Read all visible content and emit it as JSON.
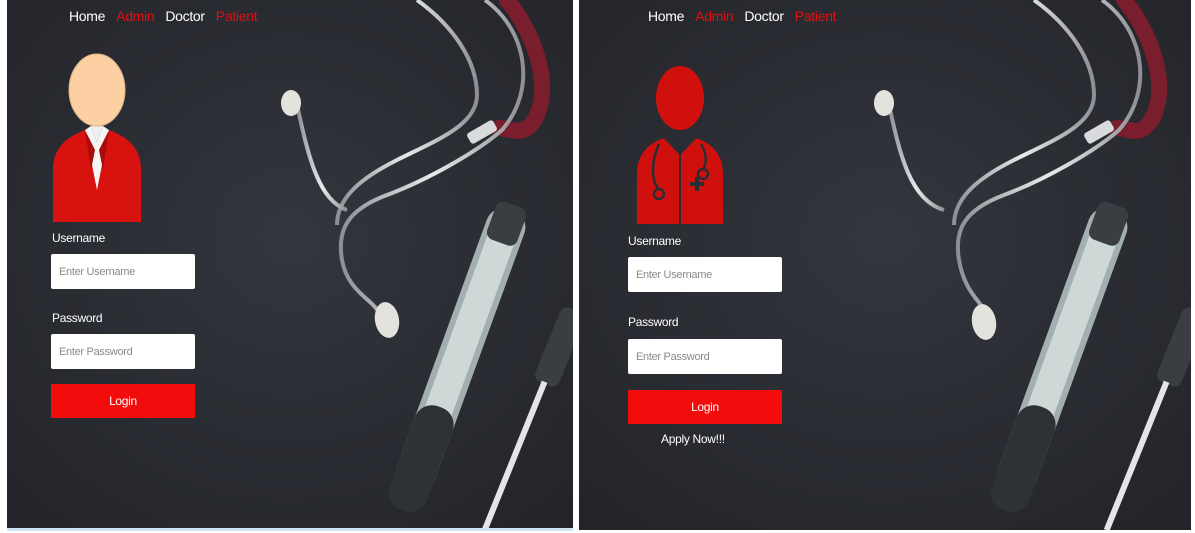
{
  "admin_panel": {
    "nav": {
      "home": "Home",
      "admin": "Admin",
      "doctor": "Doctor",
      "patient": "Patient"
    },
    "username_label": "Username",
    "username_placeholder": "Enter Username",
    "password_label": "Password",
    "password_placeholder": "Enter Password",
    "login_label": "Login",
    "avatar_icon": "admin-user-icon"
  },
  "doctor_panel": {
    "nav": {
      "home": "Home",
      "admin": "Admin",
      "doctor": "Doctor",
      "patient": "Patient"
    },
    "username_label": "Username",
    "username_placeholder": "Enter Username",
    "password_label": "Password",
    "password_placeholder": "Enter Password",
    "login_label": "Login",
    "apply_label": "Apply Now!!!",
    "avatar_icon": "doctor-icon"
  },
  "colors": {
    "accent": "#f20c0c",
    "nav_red": "#e01010",
    "background": "#2b2d34"
  }
}
